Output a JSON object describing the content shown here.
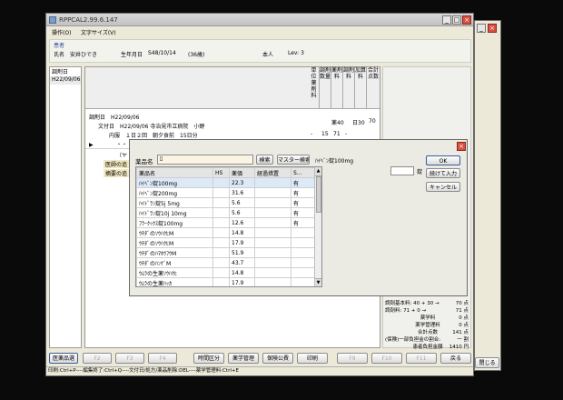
{
  "window": {
    "title": "RPPCAL2.99.6.147"
  },
  "menu": [
    "操作(O)",
    "文字サイズ(V)"
  ],
  "patient": {
    "section_label": "患者",
    "name_label": "氏名",
    "name": "安井ひでき",
    "dob_label": "生年月日",
    "dob": "S48/10/14",
    "age": "(36歳)",
    "insured_label": "本人",
    "lev": "Lev: 3"
  },
  "left_panel": {
    "header": "調剤日",
    "date": "H22/09/06"
  },
  "columns": [
    "単位薬剤料",
    "調剤数量",
    "薬剤料",
    "調剤料",
    "加算料",
    "合計点数"
  ],
  "rx": {
    "line1": "調剤日　H22/09/06",
    "line2": "文付日　H22/09/06 寺治見市立病院　小野",
    "line3": "内服　１日２回　朝夕食前　15日分",
    "line3_vals": [
      "-",
      "15",
      "71",
      "-",
      "",
      "",
      ""
    ],
    "line3_flags": [
      "薬40",
      "日30",
      "70"
    ],
    "line4": "・・・・・・",
    "section_tags": [
      "医師の追",
      "摘要の追"
    ],
    "dots": "（ヤ・・・・）"
  },
  "dialog": {
    "field_label": "薬品名",
    "field_value": "ﾛ",
    "search_btn": "検索",
    "master_btn": "マスター検索",
    "selected_name": "ﾊｲﾍﾞﾝ錠100mg",
    "qty_unit": "錠",
    "ok_btn": "OK",
    "continue_btn": "続けて入力",
    "cancel_btn": "キャンセル",
    "table_headers": [
      "薬品名",
      "HS",
      "薬価",
      "経過措置",
      "S..."
    ],
    "rows": [
      [
        "ﾊｲﾍﾞﾝ錠100mg",
        "",
        "22.3",
        "",
        "有"
      ],
      [
        "ﾊｲﾍﾞﾝ錠200mg",
        "",
        "31.6",
        "",
        "有"
      ],
      [
        "ﾊｲﾄﾞﾗﾝ錠5j 5mg",
        "",
        "5.6",
        "",
        "有"
      ],
      [
        "ﾊｲﾄﾞﾗﾝ錠10j 10mg",
        "",
        "5.6",
        "",
        "有"
      ],
      [
        "ﾌﾗｰｸｯｸｽ錠100mg",
        "",
        "12.6",
        "",
        "有"
      ],
      [
        "ｳﾁﾀﾞのｿｳﾊｸﾋM",
        "",
        "14.8",
        "",
        ""
      ],
      [
        "ｳﾁﾀﾞのｿｳﾊｸﾋM",
        "",
        "17.9",
        "",
        ""
      ],
      [
        "ｳﾁﾀﾞのﾊﾏﾎｳﾌｳM",
        "",
        "51.9",
        "",
        ""
      ],
      [
        "ｳﾁﾀﾞのﾊﾝｹﾞM",
        "",
        "43.7",
        "",
        ""
      ],
      [
        "ｳﾑﾗの生薬ｿｳﾊｸﾋ",
        "",
        "14.8",
        "",
        ""
      ],
      [
        "ｳﾑﾗの生薬ﾊｯｶ",
        "",
        "17.9",
        "",
        ""
      ],
      [
        "ｳﾑﾗの生薬ﾊﾝｹﾞ",
        "",
        "43.7",
        "",
        ""
      ]
    ]
  },
  "summary": [
    [
      "調剤基本料: 40 + 30",
      "→",
      "70 点"
    ],
    [
      "調剤料: 71 + 0",
      "→",
      "71 点"
    ],
    [
      "薬学料",
      "",
      "0 点"
    ],
    [
      "薬学管理料",
      "",
      "0 点"
    ],
    [
      "合計点数",
      "",
      "141 点"
    ],
    [
      "(保険)一部負担金の割合:",
      "",
      "一 割"
    ],
    [
      "患者負担金額",
      "",
      "1410 円"
    ]
  ],
  "bottom_buttons": [
    "医薬品選",
    "F2",
    "F3",
    "F4",
    "時間区分",
    "薬学管理",
    "保険公費",
    "印刷",
    "F9",
    "F10",
    "F11",
    "戻る"
  ],
  "side_button": "閉じる",
  "statusbar": "印刷:Ctrl+P----編集終了:Ctrl+Q----文付日/処方/薬品削除:DEL----薬学管理料:Ctrl+E"
}
